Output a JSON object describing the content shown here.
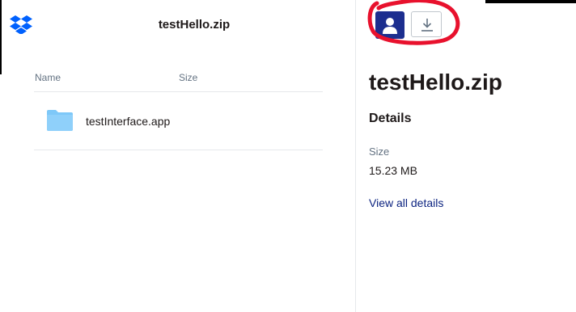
{
  "header": {
    "title": "testHello.zip",
    "logo_icon": "dropbox-logo-icon"
  },
  "file_list": {
    "columns": [
      "Name",
      "Size"
    ],
    "rows": [
      {
        "name": "testInterface.app",
        "size": "",
        "icon": "folder-icon"
      }
    ]
  },
  "sidebar": {
    "title": "testHello.zip",
    "details_heading": "Details",
    "size_label": "Size",
    "size_value": "15.23 MB",
    "view_all_link": "View all details",
    "avatar_icon": "user-avatar-icon",
    "download_icon": "download-icon",
    "annotation": "red-circle-annotation"
  },
  "colors": {
    "brand_blue": "#0061fe",
    "avatar_bg": "#1c2e8f",
    "link": "#0d2481",
    "folder": "#7ec8f8",
    "annotation_red": "#e8112d"
  }
}
